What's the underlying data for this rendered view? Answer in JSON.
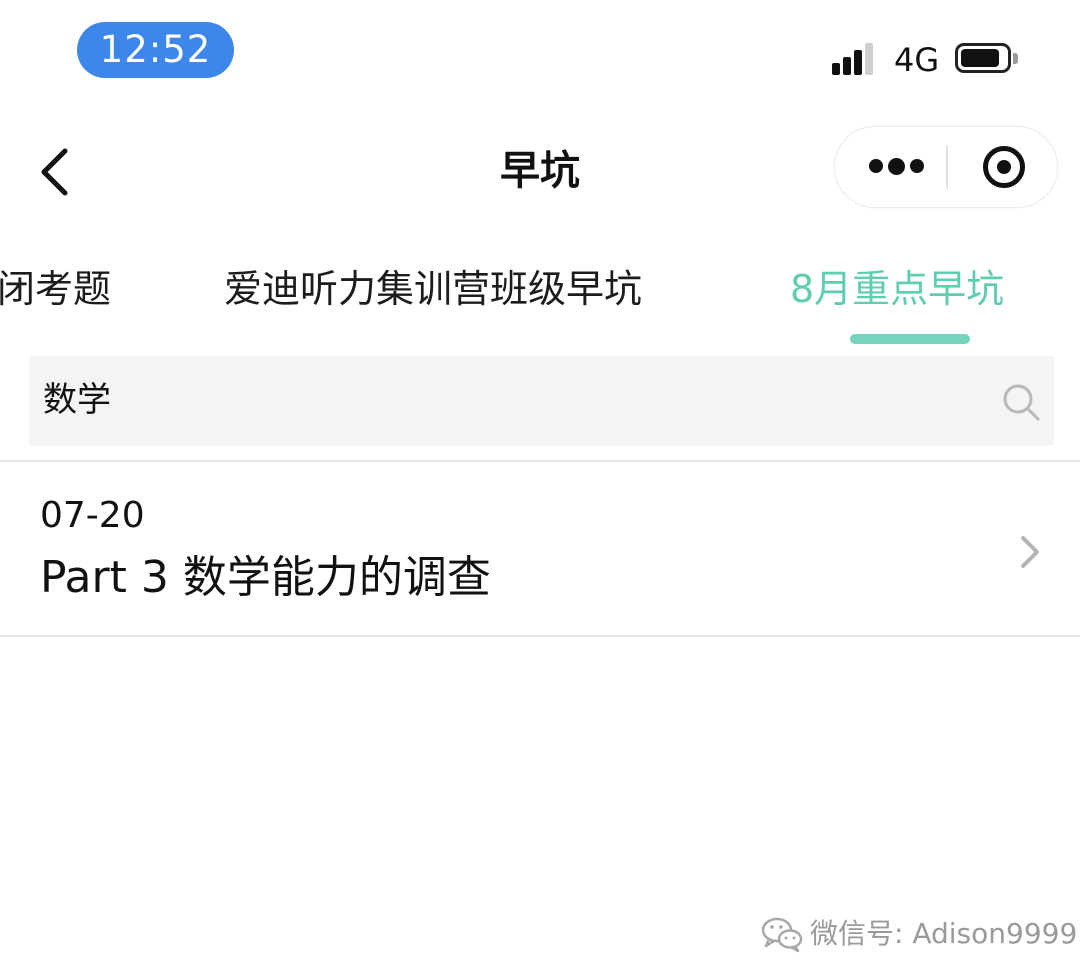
{
  "status_bar": {
    "time": "12:52",
    "network": "4G",
    "icons": [
      "signal-icon",
      "battery-icon"
    ],
    "time_pill_color": "#3d86ea"
  },
  "nav": {
    "title": "早坑",
    "back_icon": "chevron-left-icon",
    "more_icon": "more-dots-icon",
    "close_icon": "target-circle-icon"
  },
  "tabs": {
    "items": [
      {
        "label": "闭考题",
        "active": false
      },
      {
        "label": "爱迪听力集训营班级早坑",
        "active": false
      },
      {
        "label": "8月重点早坑",
        "active": true
      }
    ],
    "active_color": "#5fcdb2"
  },
  "search": {
    "value": "数学",
    "icon": "search-icon"
  },
  "list": {
    "items": [
      {
        "date": "07-20",
        "title": "Part 3 数学能力的调查",
        "icon": "chevron-right-icon"
      }
    ]
  },
  "watermark": {
    "text": "微信号: Adison9999",
    "icon": "wechat-logo-icon"
  }
}
